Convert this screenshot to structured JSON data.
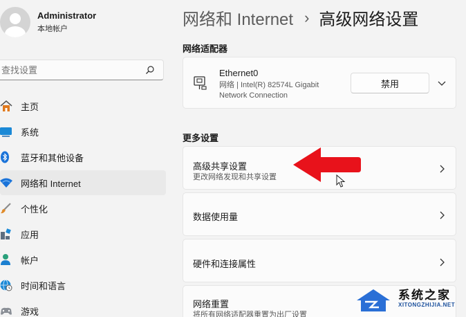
{
  "profile": {
    "name": "Administrator",
    "account_type": "本地帐户"
  },
  "search": {
    "placeholder": "查找设置"
  },
  "nav": {
    "items": [
      {
        "label": "主页",
        "icon": "home-icon"
      },
      {
        "label": "系统",
        "icon": "system-icon"
      },
      {
        "label": "蓝牙和其他设备",
        "icon": "bluetooth-icon"
      },
      {
        "label": "网络和 Internet",
        "icon": "wifi-icon",
        "active": true
      },
      {
        "label": "个性化",
        "icon": "brush-icon"
      },
      {
        "label": "应用",
        "icon": "apps-icon"
      },
      {
        "label": "帐户",
        "icon": "account-icon"
      },
      {
        "label": "时间和语言",
        "icon": "globe-clock-icon"
      },
      {
        "label": "游戏",
        "icon": "gamepad-icon"
      }
    ]
  },
  "breadcrumb": {
    "parent": "网络和 Internet",
    "separator": "›",
    "current": "高级网络设置"
  },
  "adapters": {
    "title": "网络适配器",
    "ethernet": {
      "name": "Ethernet0",
      "description": "网络 | Intel(R) 82574L Gigabit Network Connection",
      "button": "禁用"
    }
  },
  "more_settings": {
    "title": "更多设置",
    "rows": [
      {
        "title": "高级共享设置",
        "subtitle": "更改网络发现和共享设置"
      },
      {
        "title": "数据使用量",
        "subtitle": ""
      },
      {
        "title": "硬件和连接属性",
        "subtitle": ""
      },
      {
        "title": "网络重置",
        "subtitle": "将所有网络适配器重置为出厂设置"
      }
    ]
  },
  "watermark": {
    "text": "系统之家",
    "sub": "XITONGZHIJIA.NET"
  },
  "colors": {
    "accent": "#0067c0",
    "arrow": "#e8121b",
    "active_bg": "#e9e9e9"
  }
}
